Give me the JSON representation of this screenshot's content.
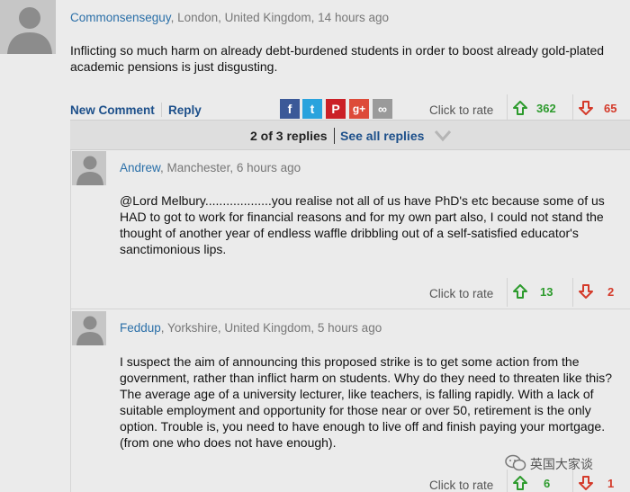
{
  "comments": [
    {
      "author": "Commonsenseguy",
      "location": ", London, United Kingdom",
      "time": ", 14 hours ago",
      "body": "Inflicting so much harm on already debt-burdened students in order to boost already gold-plated academic pensions is just disgusting.",
      "rate_label": "Click to rate",
      "up": "362",
      "down": "65"
    },
    {
      "author": "Andrew",
      "location": ", Manchester",
      "time": ", 6 hours ago",
      "body": "@Lord Melbury...................you realise not all of us have PhD's etc because some of us HAD to got to work for financial reasons and for my own part also, I could not stand the thought of another year of endless waffle dribbling out of a self-satisfied educator's sanctimonious lips.",
      "rate_label": "Click to rate",
      "up": "13",
      "down": "2"
    },
    {
      "author": "Feddup",
      "location": ", Yorkshire, United Kingdom",
      "time": ", 5 hours ago",
      "body": "I suspect the aim of announcing this proposed strike is to get some action from the government, rather than inflict harm on students. Why do they need to threaten like this? The average age of a university lecturer, like teachers, is falling rapidly. With a lack of suitable employment and opportunity for those near or over 50, retirement is the only option. Trouble is, you need to have enough to live off and finish paying your mortgage. (from one who does not have enough).",
      "rate_label": "Click to rate",
      "up": "6",
      "down": "1"
    }
  ],
  "actions": {
    "new_comment": "New Comment",
    "reply": "Reply"
  },
  "share": [
    {
      "name": "facebook",
      "glyph": "f",
      "color": "#3b5998"
    },
    {
      "name": "twitter",
      "glyph": "t",
      "color": "#2aa3dd"
    },
    {
      "name": "pinterest",
      "glyph": "P",
      "color": "#cb2027"
    },
    {
      "name": "google-plus",
      "glyph": "g+",
      "color": "#dd4b39"
    },
    {
      "name": "link",
      "glyph": "∞",
      "color": "#9a9a9a"
    }
  ],
  "replies": {
    "count_label": "2 of 3 replies",
    "see_all": "See all replies"
  },
  "watermark": "英国大家谈",
  "colors": {
    "link": "#1c4f8a",
    "author": "#2a6fa8",
    "up": "#2d9b2d",
    "down": "#d43a2a"
  }
}
